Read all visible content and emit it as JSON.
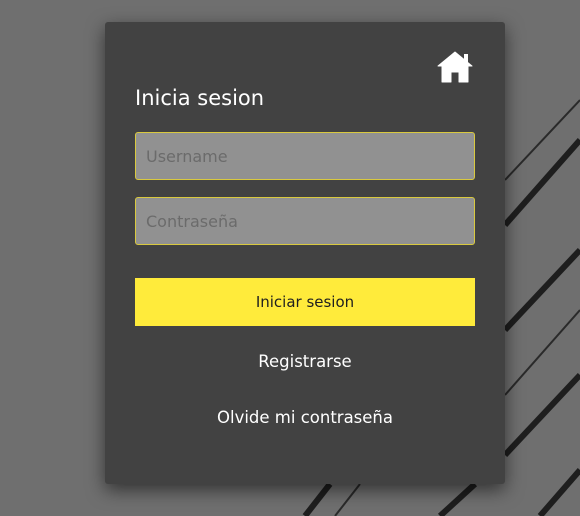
{
  "login_card": {
    "home_icon": "home-icon",
    "title": "Inicia sesion",
    "username": {
      "value": "",
      "placeholder": "Username"
    },
    "password": {
      "value": "",
      "placeholder": "Contraseña"
    },
    "submit_label": "Iniciar sesion",
    "register_label": "Registrarse",
    "forgot_label": "Olvide mi contraseña"
  },
  "colors": {
    "background": "#6f6f6f",
    "card": "#424242",
    "field_bg": "#919191",
    "field_border": "#d9c93f",
    "accent": "#ffeb3b",
    "text": "#ffffff"
  }
}
